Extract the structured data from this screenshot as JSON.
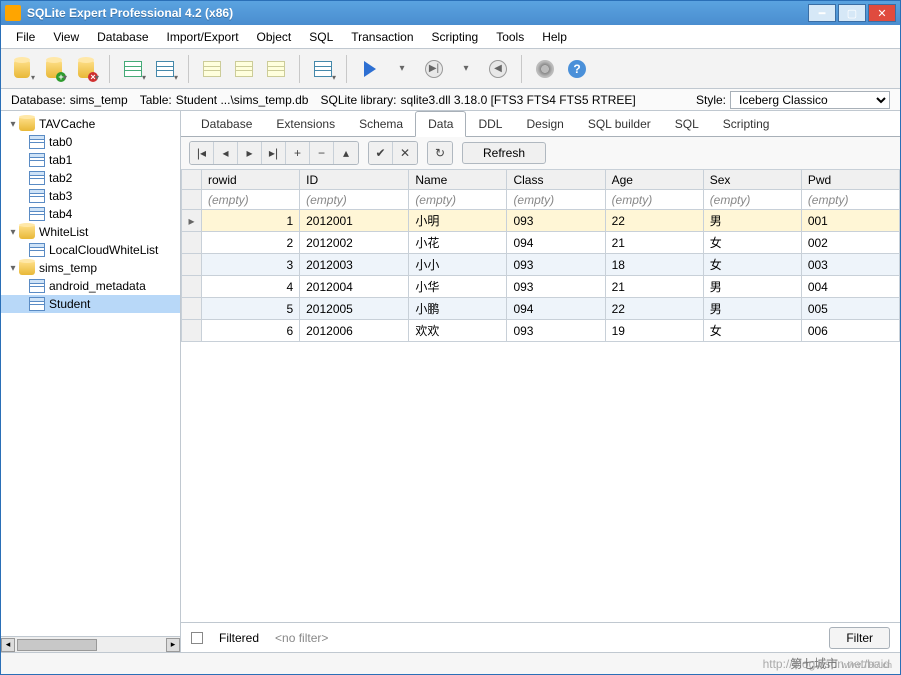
{
  "window": {
    "title": "SQLite Expert Professional 4.2 (x86)"
  },
  "menu": [
    "File",
    "View",
    "Database",
    "Import/Export",
    "Object",
    "SQL",
    "Transaction",
    "Scripting",
    "Tools",
    "Help"
  ],
  "status": {
    "database_label": "Database:",
    "database_value": "sims_temp",
    "table_label": "Table:",
    "table_value": "Student  ...\\sims_temp.db",
    "sqlite_label": "SQLite library:",
    "sqlite_value": "sqlite3.dll 3.18.0 [FTS3 FTS4 FTS5 RTREE]",
    "style_label": "Style:",
    "style_value": "Iceberg Classico"
  },
  "tree": [
    {
      "type": "db",
      "label": "TAVCache",
      "expanded": true,
      "children": [
        {
          "type": "tbl",
          "label": "tab0"
        },
        {
          "type": "tbl",
          "label": "tab1"
        },
        {
          "type": "tbl",
          "label": "tab2"
        },
        {
          "type": "tbl",
          "label": "tab3"
        },
        {
          "type": "tbl",
          "label": "tab4"
        }
      ]
    },
    {
      "type": "db",
      "label": "WhiteList",
      "expanded": true,
      "children": [
        {
          "type": "tbl",
          "label": "LocalCloudWhiteList"
        }
      ]
    },
    {
      "type": "db",
      "label": "sims_temp",
      "expanded": true,
      "children": [
        {
          "type": "tbl",
          "label": "android_metadata"
        },
        {
          "type": "tbl",
          "label": "Student",
          "selected": true
        }
      ]
    }
  ],
  "tabs": [
    "Database",
    "Extensions",
    "Schema",
    "Data",
    "DDL",
    "Design",
    "SQL builder",
    "SQL",
    "Scripting"
  ],
  "tabs_active": 3,
  "refresh_label": "Refresh",
  "columns": [
    "rowid",
    "ID",
    "Name",
    "Class",
    "Age",
    "Sex",
    "Pwd"
  ],
  "empty_label": "(empty)",
  "rows": [
    {
      "rowid": 1,
      "ID": "2012001",
      "Name": "小明",
      "Class": "093",
      "Age": "22",
      "Sex": "男",
      "Pwd": "001",
      "current": true
    },
    {
      "rowid": 2,
      "ID": "2012002",
      "Name": "小花",
      "Class": "094",
      "Age": "21",
      "Sex": "女",
      "Pwd": "002"
    },
    {
      "rowid": 3,
      "ID": "2012003",
      "Name": "小小",
      "Class": "093",
      "Age": "18",
      "Sex": "女",
      "Pwd": "003"
    },
    {
      "rowid": 4,
      "ID": "2012004",
      "Name": "小华",
      "Class": "093",
      "Age": "21",
      "Sex": "男",
      "Pwd": "004"
    },
    {
      "rowid": 5,
      "ID": "2012005",
      "Name": "小鹏",
      "Class": "094",
      "Age": "22",
      "Sex": "男",
      "Pwd": "005"
    },
    {
      "rowid": 6,
      "ID": "2012006",
      "Name": "欢欢",
      "Class": "093",
      "Age": "19",
      "Sex": "女",
      "Pwd": "006"
    }
  ],
  "filter": {
    "checkbox_label": "Filtered",
    "nofilter": "<no filter>",
    "button": "Filter"
  },
  "bottom": {
    "url": "http://blog.csdn.net/baid",
    "wm": "第七城市",
    "wm2": "www.TH7.cn"
  }
}
